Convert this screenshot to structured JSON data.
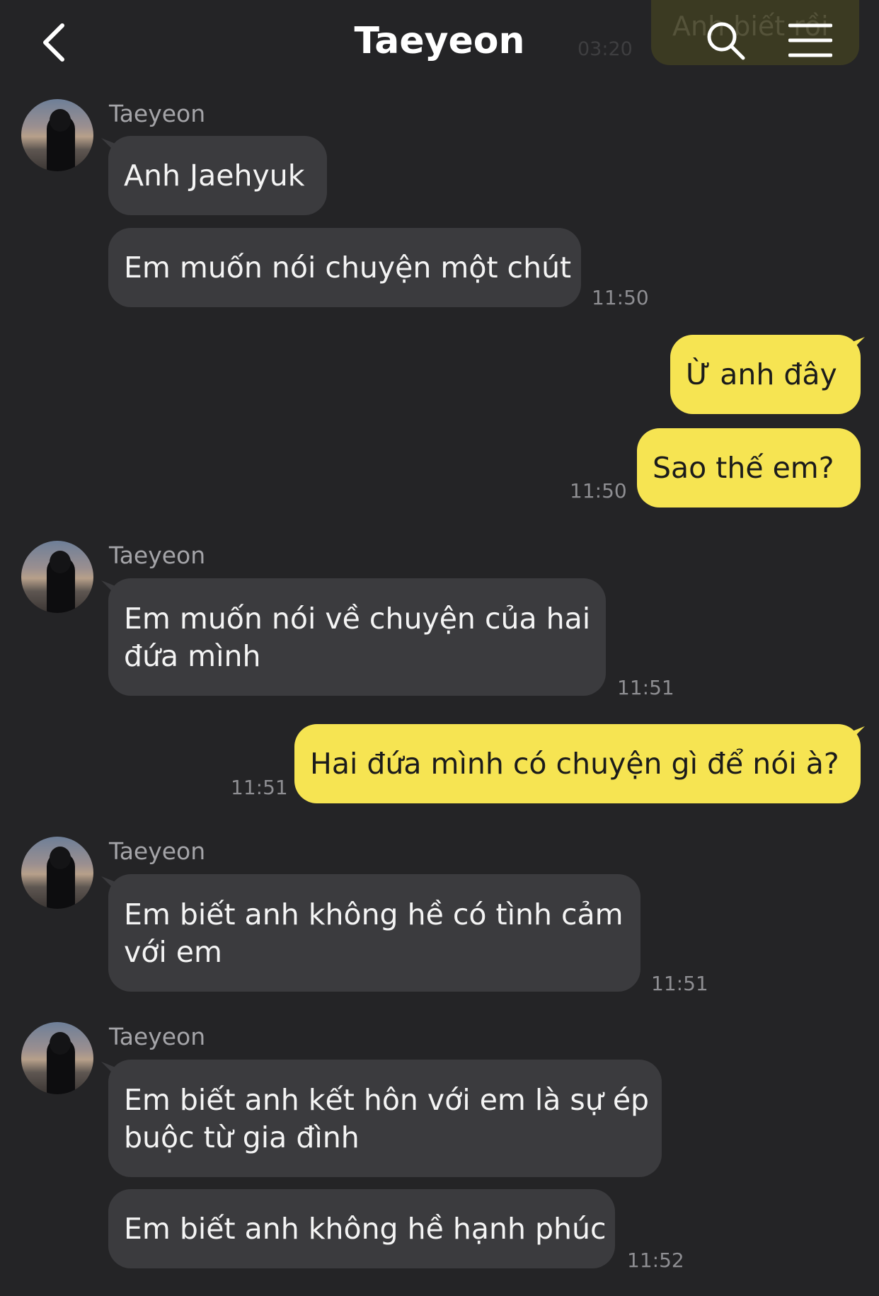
{
  "header": {
    "title": "Taeyeon",
    "back_icon": "chevron-left-icon",
    "search_icon": "search-icon",
    "menu_icon": "menu-icon"
  },
  "ghost": {
    "text": "Anh biết rồi",
    "time": "03:20"
  },
  "groups": [
    {
      "sender": "Taeyeon",
      "messages": [
        {
          "lines": [
            "Anh Jaehyuk"
          ]
        },
        {
          "lines": [
            "Em muốn nói chuyện một chút"
          ],
          "time": "11:50"
        }
      ]
    },
    {
      "sender": "me",
      "messages": [
        {
          "lines": [
            "Ừ anh đây"
          ]
        },
        {
          "lines": [
            "Sao thế em?"
          ],
          "time": "11:50"
        }
      ]
    },
    {
      "sender": "Taeyeon",
      "messages": [
        {
          "lines": [
            "Em muốn nói về chuyện của hai",
            "đứa mình"
          ],
          "time": "11:51"
        }
      ]
    },
    {
      "sender": "me",
      "messages": [
        {
          "lines": [
            "Hai đứa mình có chuyện gì để nói à?"
          ],
          "time": "11:51"
        }
      ]
    },
    {
      "sender": "Taeyeon",
      "messages": [
        {
          "lines": [
            "Em biết anh không hề có tình cảm",
            "với em"
          ],
          "time": "11:51"
        }
      ]
    },
    {
      "sender": "Taeyeon",
      "messages": [
        {
          "lines": [
            "Em biết anh kết hôn với em là sự ép",
            "buộc từ gia đình"
          ]
        },
        {
          "lines": [
            "Em biết anh không hề hạnh phúc"
          ],
          "time": "11:52"
        }
      ]
    }
  ],
  "colors": {
    "background": "#242426",
    "incoming_bubble": "#3b3b3e",
    "outgoing_bubble": "#f6e452"
  }
}
